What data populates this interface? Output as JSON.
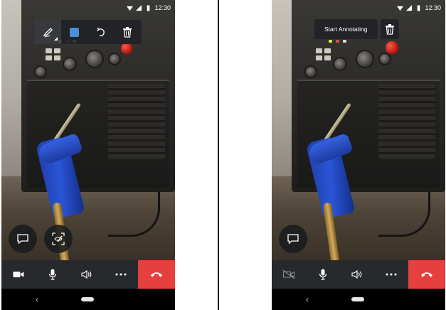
{
  "status_bar": {
    "time": "12:30"
  },
  "left_screen": {
    "toolbar": {
      "tools": [
        {
          "icon": "pen-icon",
          "selected": true
        },
        {
          "icon": "color-swatch-icon",
          "color": "#4a8fd6"
        },
        {
          "icon": "undo-icon"
        },
        {
          "icon": "trash-icon"
        }
      ]
    },
    "floating": [
      {
        "icon": "chat-icon"
      },
      {
        "icon": "annotate-view-icon"
      }
    ],
    "call_controls": [
      {
        "icon": "video-camera-icon"
      },
      {
        "icon": "microphone-icon"
      },
      {
        "icon": "speaker-icon"
      },
      {
        "icon": "more-dots-icon",
        "label": "..."
      },
      {
        "icon": "end-call-icon",
        "color": "#e5403e"
      }
    ]
  },
  "right_screen": {
    "annotate_bar": {
      "label": "Start Annotating",
      "icon": "trash-icon"
    },
    "floating": [
      {
        "icon": "chat-icon"
      }
    ],
    "call_controls": [
      {
        "icon": "video-camera-off-icon"
      },
      {
        "icon": "microphone-icon"
      },
      {
        "icon": "speaker-icon"
      },
      {
        "icon": "more-dots-icon",
        "label": "..."
      },
      {
        "icon": "end-call-icon",
        "color": "#e5403e"
      }
    ]
  },
  "nav_bar": {
    "back": "‹"
  },
  "colors": {
    "end_call": "#e5403e",
    "control_bar": "#27292c",
    "swatch_blue": "#4a8fd6"
  }
}
